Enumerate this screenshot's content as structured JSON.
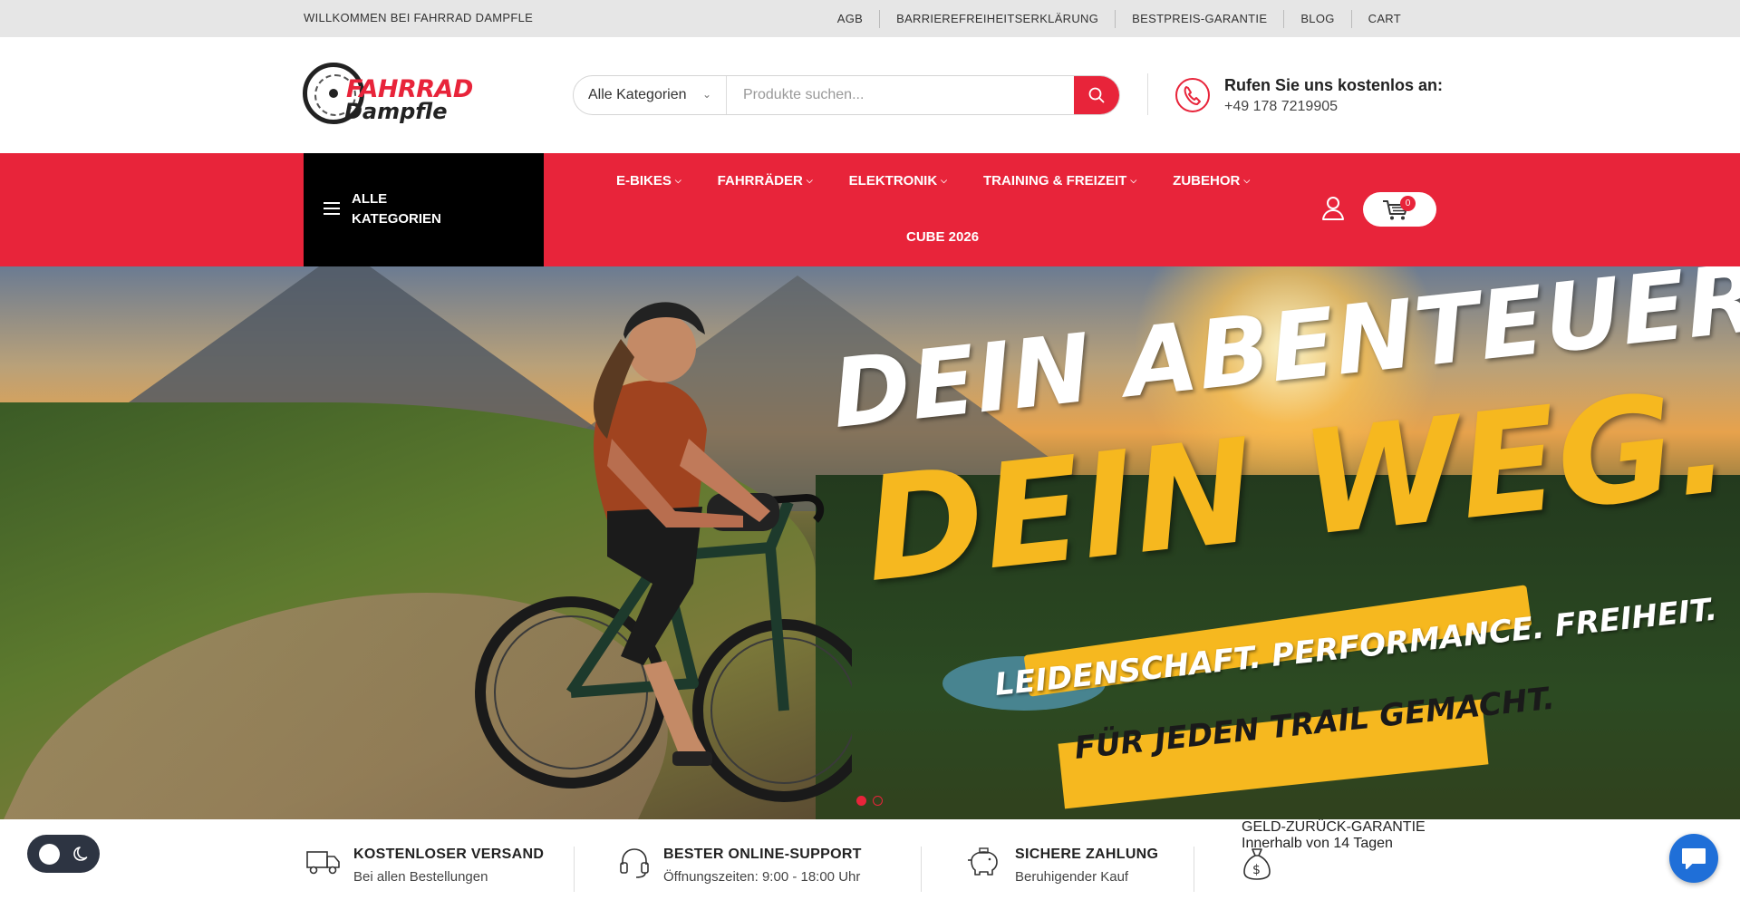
{
  "topbar": {
    "welcome": "WILLKOMMEN BEI FAHRRAD DAMPFLE",
    "links": [
      "AGB",
      "BARRIEREFREIHEITSERKLÄRUNG",
      "BESTPREIS-GARANTIE",
      "BLOG",
      "CART"
    ]
  },
  "logo": {
    "line1": "FAHRRAD",
    "line2": "Dampfle"
  },
  "search": {
    "category": "Alle Kategorien",
    "placeholder": "Produkte suchen...",
    "value": ""
  },
  "contact": {
    "label": "Rufen Sie uns kostenlos an:",
    "phone": "+49 178 7219905"
  },
  "nav": {
    "all_categories": "ALLE KATEGORIEN",
    "items": [
      "E-BIKES",
      "FAHRRÄDER",
      "ELEKTRONIK",
      "TRAINING & FREIZEIT",
      "ZUBEHOR"
    ],
    "second_row": "CUBE 2026",
    "cart_count": "0"
  },
  "hero": {
    "line1": "DEIN ABENTEUER.",
    "line2": "DEIN WEG.",
    "line3": "LEIDENSCHAFT. PERFORMANCE. FREIHEIT.",
    "line4": "FÜR JEDEN TRAIL GEMACHT.",
    "slide_count": 2,
    "active_slide": 1
  },
  "features": [
    {
      "title": "KOSTENLOSER VERSAND",
      "subtitle": "Bei allen Bestellungen",
      "icon": "truck-icon"
    },
    {
      "title": "BESTER ONLINE-SUPPORT",
      "subtitle": "Öffnungszeiten: 9:00 - 18:00 Uhr",
      "icon": "headset-icon"
    },
    {
      "title": "SICHERE ZAHLUNG",
      "subtitle": "Beruhigender Kauf",
      "icon": "piggy-bank-icon"
    },
    {
      "title": "GELD-ZURÜCK-GARANTIE",
      "subtitle": "Innerhalb von 14 Tagen",
      "icon": "money-bag-icon"
    }
  ],
  "colors": {
    "accent": "#e8243a",
    "dark": "#000000",
    "hero_yellow": "#f6b81f",
    "chat_blue": "#1f6fd8"
  }
}
